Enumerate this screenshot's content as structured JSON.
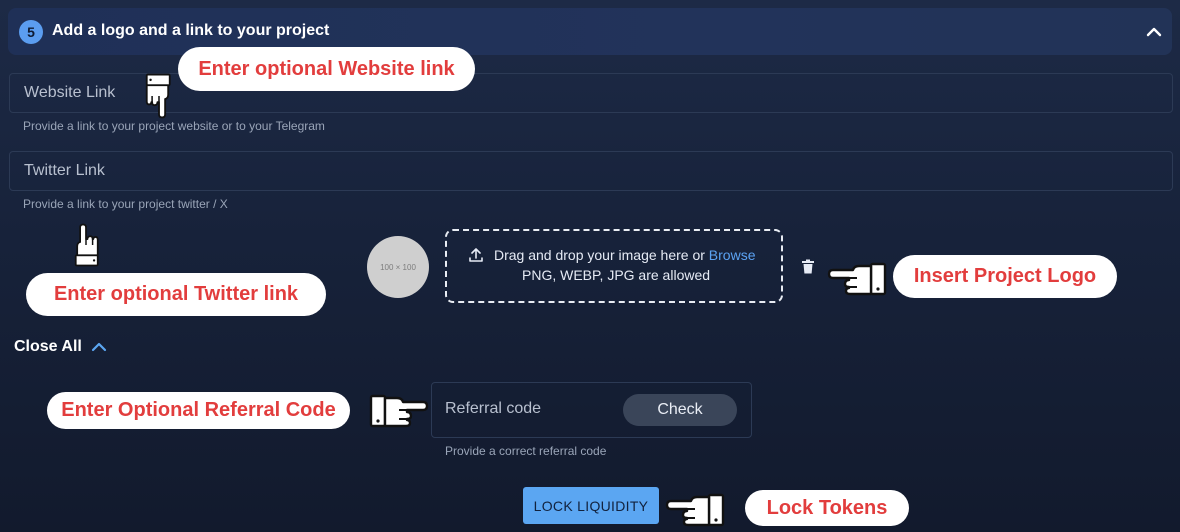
{
  "header": {
    "step_number": "5",
    "title": "Add a logo and a link to your project"
  },
  "website": {
    "placeholder": "Website Link",
    "helper": "Provide a link to your project website or to your Telegram"
  },
  "twitter": {
    "placeholder": "Twitter Link",
    "helper": "Provide a link to your project twitter / X"
  },
  "logo": {
    "placeholder_text": "100 × 100",
    "drop_text": "Drag and drop your image here or",
    "browse_label": "Browse",
    "formats_text": "PNG, WEBP, JPG are allowed"
  },
  "close_all_label": "Close All",
  "referral": {
    "placeholder": "Referral code",
    "check_label": "Check",
    "helper": "Provide a correct referral code"
  },
  "lock_button_label": "LOCK LIQUIDITY",
  "callouts": {
    "website": "Enter optional Website link",
    "twitter": "Enter optional Twitter link",
    "logo": "Insert Project Logo",
    "referral": "Enter Optional Referral Code",
    "lock": "Lock Tokens"
  },
  "colors": {
    "accent": "#5ba6f2",
    "callout_text": "#e23d3d",
    "background": "#17223a"
  },
  "icons": [
    "chevron-up-icon",
    "upload-icon",
    "trash-icon",
    "pointing-hand-icon"
  ]
}
